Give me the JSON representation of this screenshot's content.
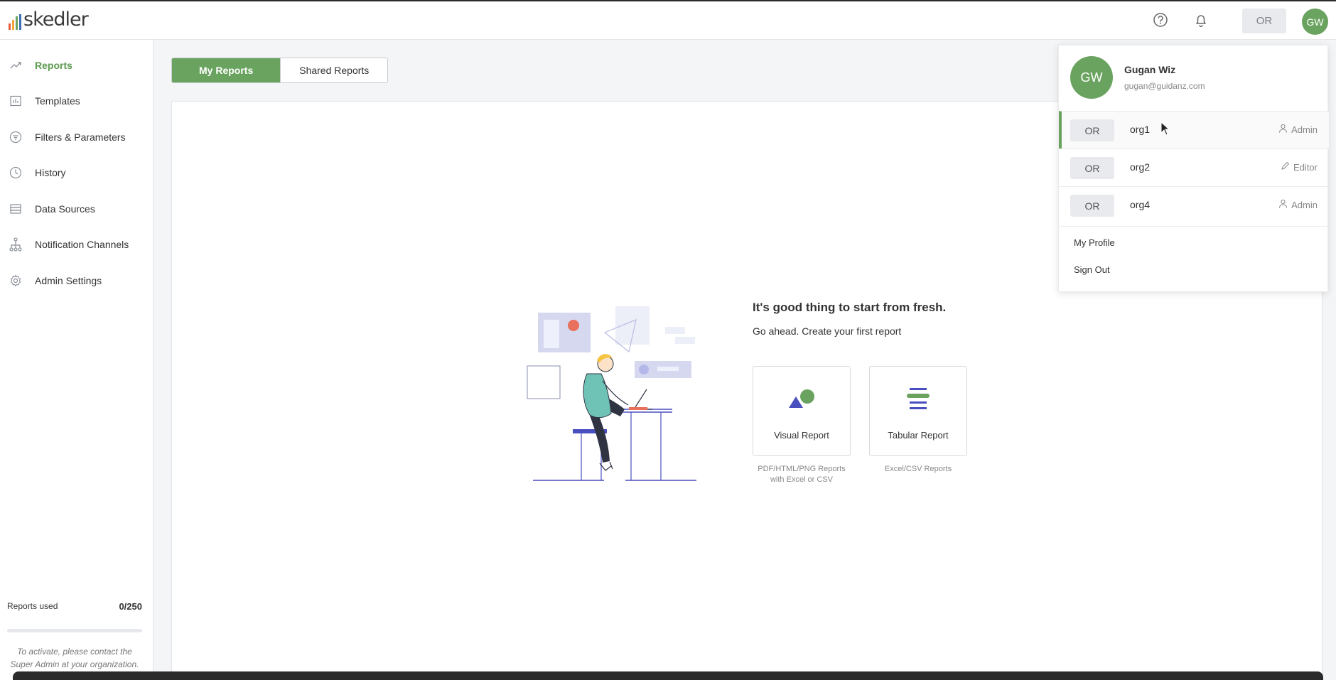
{
  "brand": {
    "logo_text": "skedler",
    "bar_colors": [
      "#e25c3b",
      "#f3a33a",
      "#6aa35f",
      "#3d6fb6"
    ]
  },
  "topbar": {
    "help_icon": "help-circle-icon",
    "bell_icon": "bell-icon",
    "org_chip": "OR",
    "avatar_initials": "GW"
  },
  "sidebar": {
    "items": [
      {
        "label": "Reports",
        "icon": "trend-icon",
        "active": true
      },
      {
        "label": "Templates",
        "icon": "template-icon"
      },
      {
        "label": "Filters & Parameters",
        "icon": "filter-icon"
      },
      {
        "label": "History",
        "icon": "clock-icon"
      },
      {
        "label": "Data Sources",
        "icon": "database-icon"
      },
      {
        "label": "Notification Channels",
        "icon": "hierarchy-icon"
      },
      {
        "label": "Admin Settings",
        "icon": "gear-icon"
      }
    ],
    "usage": {
      "label": "Reports used",
      "value": "0/250",
      "fraction": 0,
      "note": "To activate, please contact the Super Admin at your organization."
    }
  },
  "main": {
    "tabs": [
      {
        "label": "My Reports",
        "active": true
      },
      {
        "label": "Shared Reports"
      }
    ],
    "empty_state": {
      "title": "It's good thing to start from fresh.",
      "subtitle": "Go ahead. Create your first report",
      "cards": [
        {
          "label": "Visual Report",
          "description": "PDF/HTML/PNG Reports with Excel or CSV",
          "icon": "shapes-icon"
        },
        {
          "label": "Tabular Report",
          "description": "Excel/CSV Reports",
          "icon": "table-lines-icon"
        }
      ]
    }
  },
  "user_menu": {
    "avatar_initials": "GW",
    "name": "Gugan Wiz",
    "email": "gugan@guidanz.com",
    "orgs": [
      {
        "chip": "OR",
        "name": "org1",
        "role": "Admin",
        "role_icon": "user-icon",
        "active": true
      },
      {
        "chip": "OR",
        "name": "org2",
        "role": "Editor",
        "role_icon": "pencil-icon"
      },
      {
        "chip": "OR",
        "name": "org4",
        "role": "Admin",
        "role_icon": "user-icon"
      }
    ],
    "links": [
      "My Profile",
      "Sign Out"
    ]
  },
  "colors": {
    "accent": "#6aa35f",
    "indigo": "#4a4fbf"
  }
}
